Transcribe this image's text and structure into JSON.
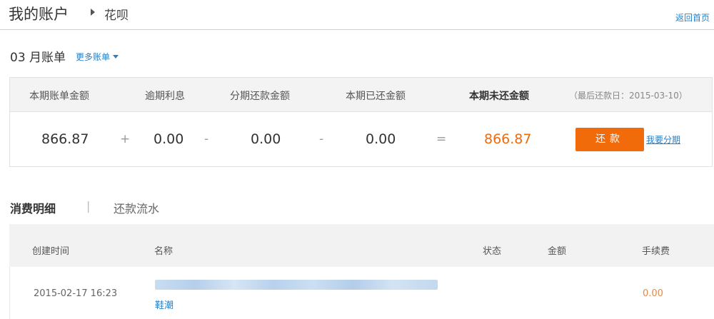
{
  "header": {
    "title": "我的账户",
    "breadcrumb": "花呗",
    "back_link": "返回首页"
  },
  "bill": {
    "month_label": "03 月账单",
    "more_bills": "更多账单",
    "columns": {
      "bill_amount": "本期账单金额",
      "overdue_interest": "逾期利息",
      "installment_amount": "分期还款金额",
      "paid_amount": "本期已还金额",
      "unpaid_amount": "本期未还金额",
      "due_date": "（最后还款日：2015-03-10）"
    },
    "values": {
      "bill_amount": "866.87",
      "overdue_interest": "0.00",
      "installment_amount": "0.00",
      "paid_amount": "0.00",
      "unpaid_amount": "866.87"
    },
    "operators": [
      "+",
      "-",
      "-",
      "="
    ],
    "pay_button": "还款",
    "installment_link": "我要分期"
  },
  "tabs": {
    "active": "消费明细",
    "separator": "|",
    "inactive": "还款流水"
  },
  "table": {
    "headers": {
      "created_time": "创建时间",
      "name": "名称",
      "status": "状态",
      "amount": "金额",
      "fee": "手续费"
    },
    "rows": [
      {
        "created_time": "2015-02-17 16:23",
        "tag": "鞋潮",
        "fee": "0.00"
      }
    ]
  },
  "colors": {
    "accent_orange": "#f26b0a",
    "link_blue": "#2a7fc4",
    "header_bg": "#f3f3f3"
  }
}
